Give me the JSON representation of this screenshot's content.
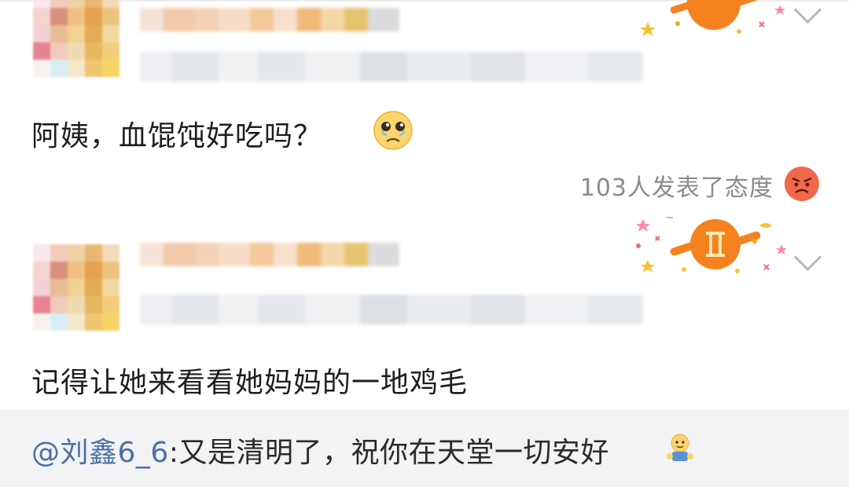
{
  "comments": [
    {
      "text": "阿姨，血馄饨好吃吗？",
      "emoji": "tearful-sad-face-emoji",
      "reaction_text": "103人发表了态度",
      "reaction_emoji": "angry-face-emoji",
      "badge": "gemini-zodiac-badge"
    },
    {
      "text": "记得让她来看看她妈妈的一地鸡毛",
      "badge": "gemini-zodiac-badge"
    }
  ],
  "reply": {
    "mention": "@刘鑫6_6",
    "text": ":又是清明了，祝你在天堂一切安好",
    "emoji": "pray-emoji"
  },
  "colors": {
    "mention": "#4a6fa5",
    "badge_orange": "#f5821f",
    "reply_bg": "#f3f3f5",
    "meta_text": "#8b8b8b"
  }
}
